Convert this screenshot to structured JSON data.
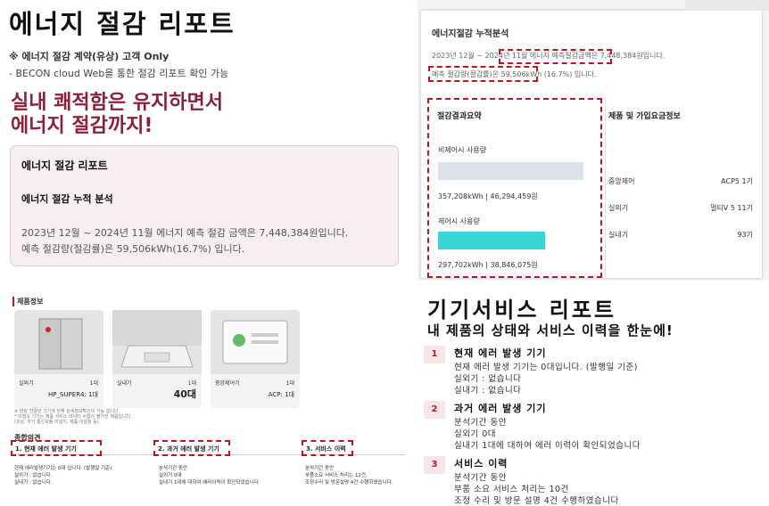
{
  "top_left": {
    "title": "에너지 절감 리포트",
    "note1": "※ 에너지 절감 계약(유상) 고객 Only",
    "note2": "- BECON cloud Web을 통한 절감 리포트 확인 가능",
    "headline1": "실내 쾌적함은 유지하면서",
    "headline2": "에너지 절감까지!",
    "box": {
      "title": "에너지 절감 리포트",
      "subtitle": "에너지 절감 누적 분석",
      "line1": "2023년 12월 ~ 2024년 11월 에너지 예측 절감 금액은 7,448,384원입니다.",
      "line2": "예측 절감량(절감률)은 59,506kWh(16.7%) 입니다."
    }
  },
  "top_right": {
    "title": "에너지절감 누적분석",
    "line1": "2023년 12월 ~ 2024년 11월 에너지 예측절감금액은 7,448,384원입니다.",
    "line2": "예측 절감량(절감률)은 59,506kWh (16.7%) 입니다.",
    "summary_title": "절감결과요약",
    "non_control_label": "비제어시 사용량",
    "non_control_value": "357,208kWh | 46,294,459원",
    "control_label": "제어시 사용량",
    "control_value": "297,702kWh | 38,846,075원",
    "usage_bars": {
      "non_control_kwh": 357208,
      "control_kwh": 297702
    },
    "product_title": "제품 및 가입요금정보",
    "products": [
      {
        "label": "중앙제어",
        "value": "ACP5 1기"
      },
      {
        "label": "실외기",
        "value": "멀티V 5 11기"
      },
      {
        "label": "실내기",
        "value": "93기"
      }
    ],
    "colors": {
      "control_bar": "#35d8d6",
      "non_control_bar": "#dde2ea",
      "highlight": "#c0141d"
    }
  },
  "bottom_left": {
    "section_title": "제품정보",
    "cards": [
      {
        "name": "실외기",
        "count": "1대",
        "model": "HP_SUPER4: 1대"
      },
      {
        "name": "실내기",
        "count": "1대",
        "big": "40대"
      },
      {
        "name": "중앙제어기",
        "count": "1대",
        "model": "ACP: 1대"
      }
    ],
    "footnotes": [
      "※ 현장 연결된 기기에 한해 상세정보확인이 가능 합니다.",
      "* 미접속 기기는 제품 서비스 데이터 수집이 불가한 제품입니다.",
      "(유상, 추가 통신모듈 미설치, 제품 미설정 등)"
    ],
    "overview_title": "종합의견",
    "sections": [
      {
        "title": "1. 현재 에러 발생 기기",
        "lines": [
          "현재 에러발생기기는 0대 입니다. (발행일 기준)",
          "실외기 : 없습니다.",
          "실내기 : 없습니다."
        ]
      },
      {
        "title": "2. 과거 에러 발생 기기",
        "lines": [
          "분석기간 동안",
          "실외기 0대",
          "실내기 1대에 대하여 에러이력이 확인되었습니다."
        ]
      },
      {
        "title": "3. 서비스 이력",
        "lines": [
          "분석기간 동안",
          "부품소요 서비스 처리는 12건,",
          "조정수리 및 방문설명 4건 수행하였습니다."
        ]
      }
    ]
  },
  "bottom_right": {
    "title": "기기서비스 리포트",
    "subtitle": "내 제품의 상태와 서비스 이력을 한눈에!",
    "sections": [
      {
        "num": "1",
        "title": "현재 에러 발생 기기",
        "lines": [
          "현재 에러 발생 기기는 0대입니다. (발행일 기준)",
          "실외기 : 없습니다",
          "실내기 : 없습니다"
        ]
      },
      {
        "num": "2",
        "title": "과거 에러 발생 기기",
        "lines": [
          "분석기간 동안",
          "실외기 0대",
          "실내기 1대에 대하여 에러 이력이 확인되었습니다"
        ]
      },
      {
        "num": "3",
        "title": "서비스 이력",
        "lines": [
          "분석기간 동안",
          "부품 소요 서비스 처리는 10건",
          "조정 수리 및 방문 설명 4건 수행하였습니다"
        ]
      }
    ]
  }
}
